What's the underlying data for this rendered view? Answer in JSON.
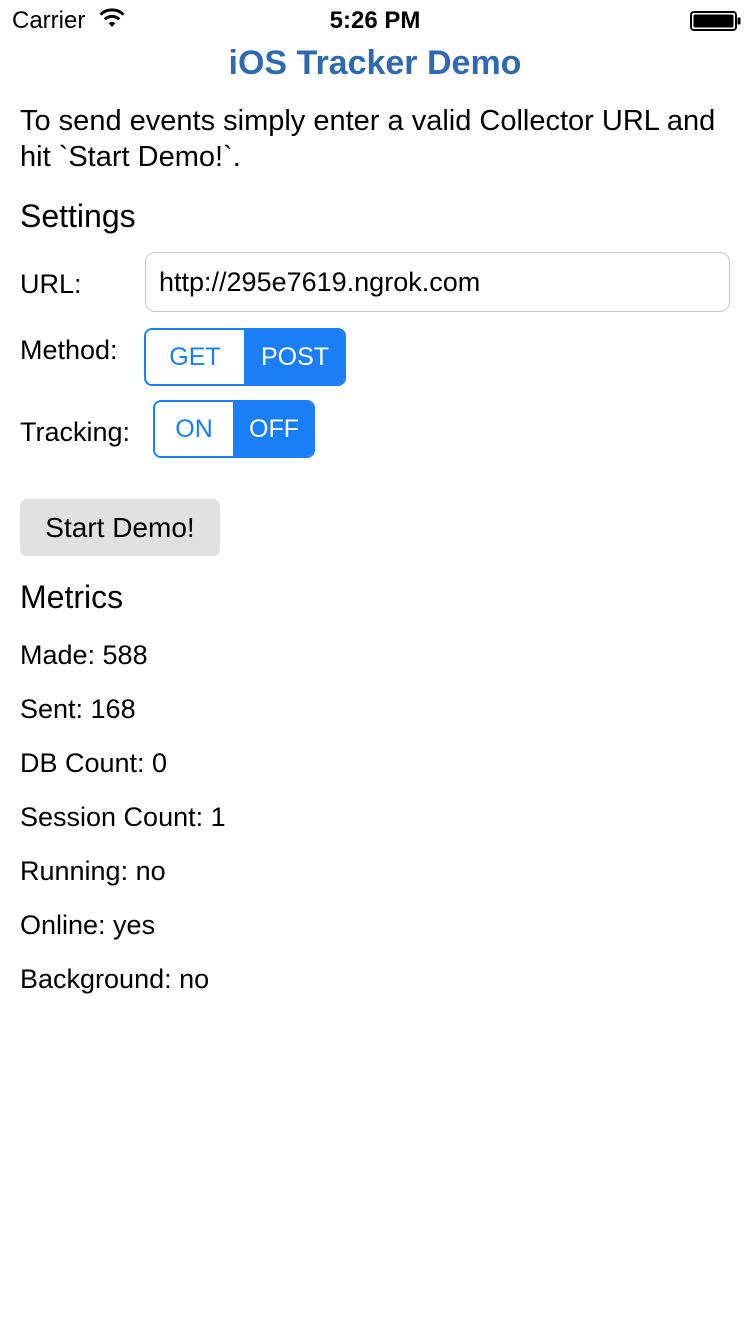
{
  "status_bar": {
    "carrier": "Carrier",
    "time": "5:26 PM",
    "wifi_icon": "wifi-icon",
    "battery_icon": "battery-full-icon"
  },
  "app": {
    "title": "iOS Tracker Demo",
    "intro": "To send events simply enter a valid Collector URL and hit `Start Demo!`.",
    "title_color": "#2e6aad",
    "accent_color": "#1a7ef7"
  },
  "settings": {
    "heading": "Settings",
    "url_label": "URL:",
    "url_value": "http://295e7619.ngrok.com",
    "method_label": "Method:",
    "method_options": [
      "GET",
      "POST"
    ],
    "method_selected": "POST",
    "tracking_label": "Tracking:",
    "tracking_options": [
      "ON",
      "OFF"
    ],
    "tracking_selected": "OFF"
  },
  "start_button": {
    "label": "Start Demo!"
  },
  "metrics": {
    "heading": "Metrics",
    "items": [
      "Made: 588",
      "Sent: 168",
      "DB Count: 0",
      "Session Count: 1",
      "Running: no",
      "Online: yes",
      "Background: no"
    ]
  }
}
